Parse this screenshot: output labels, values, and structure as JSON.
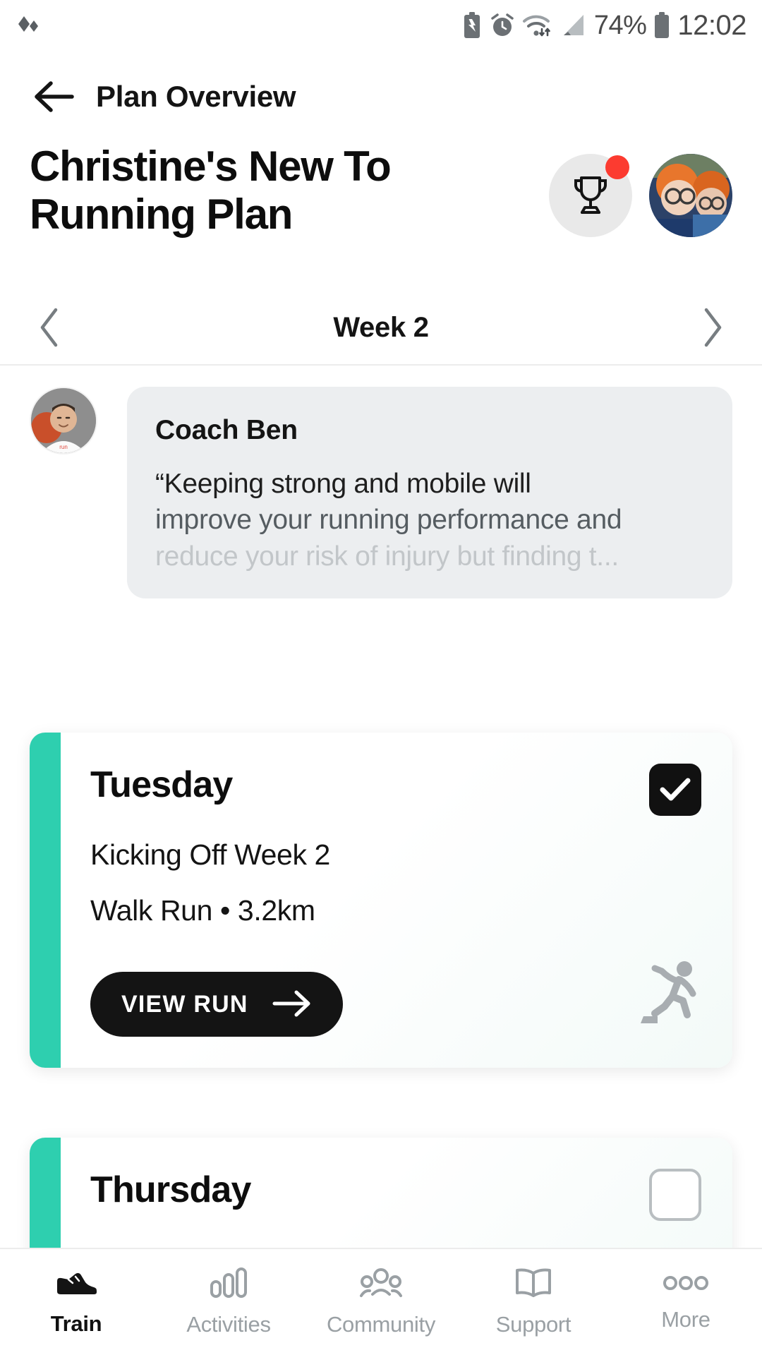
{
  "status_bar": {
    "battery_percent": "74%",
    "clock": "12:02",
    "icons": [
      "battery-saver-icon",
      "alarm-icon",
      "wifi-icon",
      "signal-icon",
      "battery-icon"
    ]
  },
  "top_bar": {
    "back_icon": "back-arrow-icon",
    "title": "Plan Overview"
  },
  "plan_header": {
    "title": "Christine's New To Running Plan",
    "trophy_icon": "trophy-icon",
    "has_notification": true,
    "avatar": "user-avatar"
  },
  "week_nav": {
    "prev_icon": "chevron-left-icon",
    "label": "Week 2",
    "next_icon": "chevron-right-icon"
  },
  "coach_message": {
    "avatar": "coach-avatar",
    "name": "Coach Ben",
    "quote_line_1": "“Keeping strong and mobile will",
    "quote_line_2": "improve your running performance and",
    "quote_line_3": "reduce your risk of injury but finding t..."
  },
  "day_cards": [
    {
      "day": "Tuesday",
      "workout_title": "Kicking Off Week 2",
      "workout_meta": "Walk Run • 3.2km",
      "completed": true,
      "button_label": "VIEW RUN",
      "button_icon": "arrow-right-icon",
      "activity_icon": "runner-icon"
    },
    {
      "day": "Thursday",
      "completed": false
    }
  ],
  "bottom_nav": [
    {
      "label": "Train",
      "icon": "shoe-icon",
      "active": true
    },
    {
      "label": "Activities",
      "icon": "bar-chart-icon",
      "active": false
    },
    {
      "label": "Community",
      "icon": "people-icon",
      "active": false
    },
    {
      "label": "Support",
      "icon": "book-icon",
      "active": false
    },
    {
      "label": "More",
      "icon": "more-dots-icon",
      "active": false
    }
  ],
  "colors": {
    "accent_teal": "#2ECFAF",
    "notification_red": "#FC3B30",
    "dark": "#141414",
    "bubble_grey": "#ECEEF0"
  }
}
